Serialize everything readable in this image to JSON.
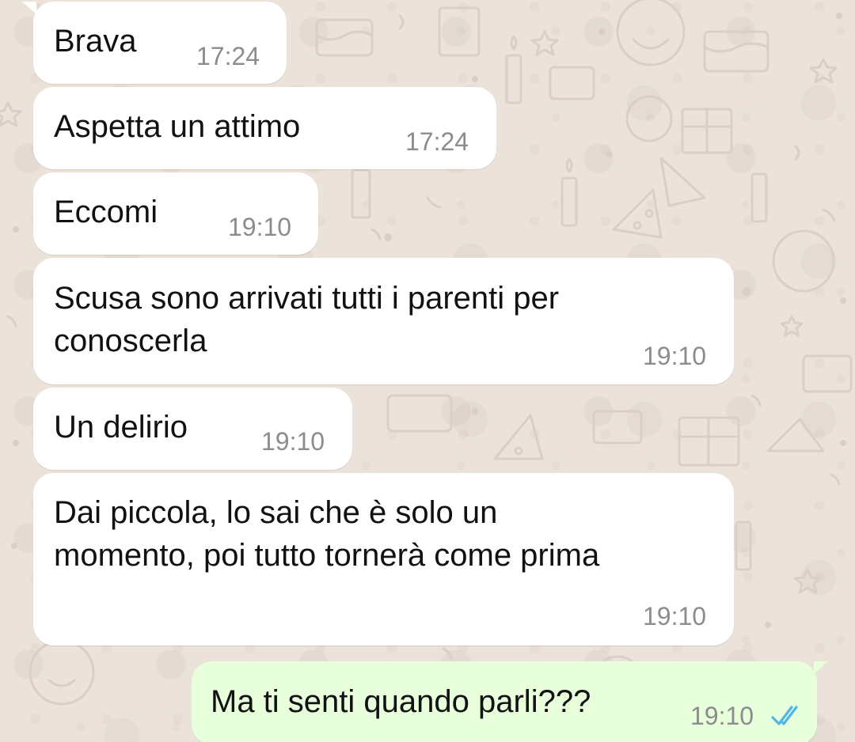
{
  "colors": {
    "incoming_bubble": "#ffffff",
    "outgoing_bubble": "#e7ffdb",
    "read_ticks": "#4fb6ec",
    "timestamp": "#8c8c8c",
    "wallpaper": "#ebe3da"
  },
  "messages": [
    {
      "direction": "incoming",
      "text": "Brava",
      "time": "17:24"
    },
    {
      "direction": "incoming",
      "text": "Aspetta un attimo",
      "time": "17:24"
    },
    {
      "direction": "incoming",
      "text": "Eccomi",
      "time": "19:10"
    },
    {
      "direction": "incoming",
      "text": "Scusa sono arrivati tutti i parenti per\nconoscerla",
      "time": "19:10"
    },
    {
      "direction": "incoming",
      "text": "Un delirio",
      "time": "19:10"
    },
    {
      "direction": "incoming",
      "text": "Dai piccola, lo sai che è solo un\nmomento, poi tutto tornerà come prima",
      "time": "19:10"
    },
    {
      "direction": "outgoing",
      "text": "Ma ti senti quando parli???",
      "time": "19:10",
      "status_icon": "double-check-read-icon"
    }
  ]
}
